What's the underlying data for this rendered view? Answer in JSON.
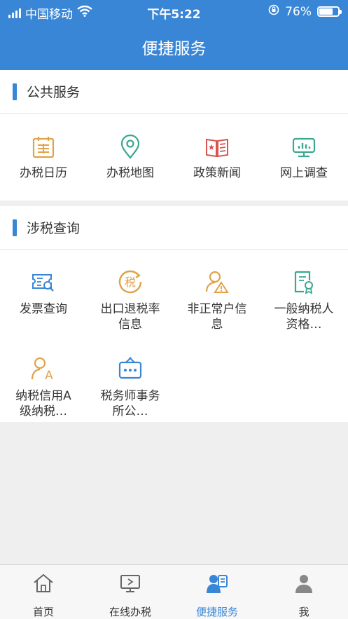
{
  "status": {
    "carrier": "中国移动",
    "time": "下午5:22",
    "battery": "76%",
    "battery_level": 0.76
  },
  "nav": {
    "title": "便捷服务"
  },
  "sections": [
    {
      "title": "公共服务",
      "items": [
        {
          "label": "办税日历",
          "icon": "calendar-icon",
          "color": "#e0a24a"
        },
        {
          "label": "办税地图",
          "icon": "map-pin-icon",
          "color": "#3aa88f"
        },
        {
          "label": "政策新闻",
          "icon": "news-book-icon",
          "color": "#d9534f"
        },
        {
          "label": "网上调查",
          "icon": "survey-monitor-icon",
          "color": "#3aa88f"
        }
      ]
    },
    {
      "title": "涉税查询",
      "items": [
        {
          "label": "发票查询",
          "icon": "invoice-search-icon",
          "color": "#3a86d6"
        },
        {
          "label": "出口退税率信息",
          "icon": "tax-refund-icon",
          "color": "#e0a24a"
        },
        {
          "label": "非正常户信息",
          "icon": "user-warning-icon",
          "color": "#e0a24a"
        },
        {
          "label": "一般纳税人资格…",
          "icon": "certificate-icon",
          "color": "#3aa88f"
        },
        {
          "label": "纳税信用A级纳税…",
          "icon": "credit-a-icon",
          "color": "#e0a24a"
        },
        {
          "label": "税务师事务所公…",
          "icon": "office-sign-icon",
          "color": "#3a86d6"
        }
      ]
    }
  ],
  "tabs": [
    {
      "label": "首页",
      "icon": "home-icon",
      "active": false
    },
    {
      "label": "在线办税",
      "icon": "online-monitor-icon",
      "active": false
    },
    {
      "label": "便捷服务",
      "icon": "convenience-icon",
      "active": true
    },
    {
      "label": "我",
      "icon": "profile-icon",
      "active": false
    }
  ],
  "colors": {
    "primary": "#3a86d6",
    "background": "#efefef"
  }
}
